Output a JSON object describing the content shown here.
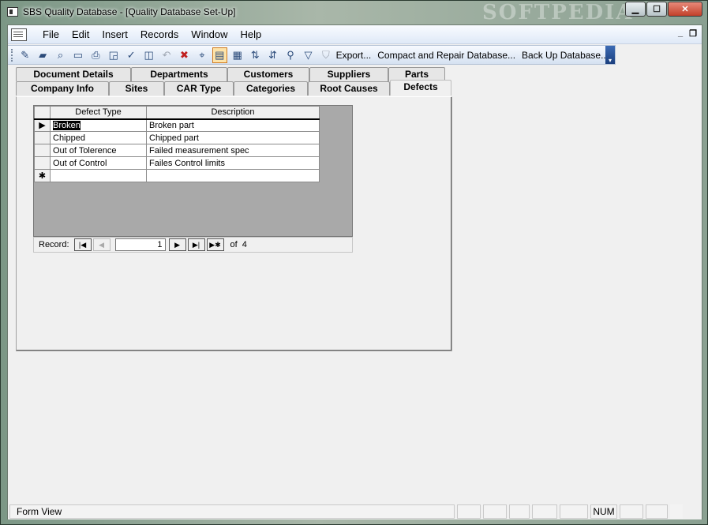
{
  "window": {
    "title": "SBS Quality Database - [Quality Database Set-Up]",
    "watermark": "SOFTPEDIA",
    "minimize_glyph": "▁",
    "maximize_glyph": "☐",
    "close_glyph": "✕"
  },
  "menu": {
    "items": [
      {
        "label": "File"
      },
      {
        "label": "Edit"
      },
      {
        "label": "Insert"
      },
      {
        "label": "Records"
      },
      {
        "label": "Window"
      },
      {
        "label": "Help"
      }
    ],
    "mdi_min": "_",
    "mdi_restore": "❐"
  },
  "toolbar": {
    "export_label": "Export...",
    "compact_label": "Compact and Repair Database...",
    "backup_label": "Back Up Database..."
  },
  "tabs": {
    "row1": [
      "Document Details",
      "Departments",
      "Customers",
      "Suppliers",
      "Parts"
    ],
    "row2": [
      "Company Info",
      "Sites",
      "CAR Type",
      "Categories",
      "Root Causes",
      "Defects"
    ],
    "active": "Defects"
  },
  "datasheet": {
    "columns": [
      "Defect Type",
      "Description"
    ],
    "rows": [
      {
        "type": "Broken",
        "desc": "Broken part"
      },
      {
        "type": "Chipped",
        "desc": "Chipped part"
      },
      {
        "type": "Out of Tolerence",
        "desc": "Failed measurement spec"
      },
      {
        "type": "Out of Control",
        "desc": "Failes Control limits"
      }
    ],
    "current_row_marker": "▶",
    "new_row_marker": "✱"
  },
  "navigator": {
    "label": "Record:",
    "current": "1",
    "of_label": "of",
    "total": "4"
  },
  "statusbar": {
    "mode": "Form View",
    "num": "NUM"
  }
}
